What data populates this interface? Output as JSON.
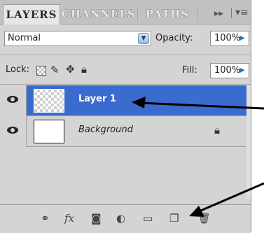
{
  "tabs": [
    {
      "label": "LAYERS",
      "active": true
    },
    {
      "label": "CHANNELS",
      "active": false
    },
    {
      "label": "PATHS",
      "active": false
    }
  ],
  "panel_menu": {
    "collapse_icon": "double-arrow-icon",
    "menu_icon": "panel-menu-icon"
  },
  "blend_mode": {
    "value": "Normal"
  },
  "opacity": {
    "label": "Opacity:",
    "value": "100%"
  },
  "lock": {
    "label": "Lock:"
  },
  "fill": {
    "label": "Fill:",
    "value": "100%"
  },
  "layers": [
    {
      "name": "Layer 1",
      "selected": true,
      "visible": true
    },
    {
      "name": "Background",
      "selected": false,
      "visible": true,
      "locked": true
    }
  ],
  "colors": {
    "selection": "#3a6cd0",
    "panel_bg": "#d4d4d4",
    "arrow": "#000000"
  },
  "toolbar_icons": [
    "link-layers-icon",
    "layer-style-icon",
    "layer-mask-icon",
    "adjustment-layer-icon",
    "new-group-icon",
    "new-layer-icon",
    "delete-layer-icon"
  ]
}
